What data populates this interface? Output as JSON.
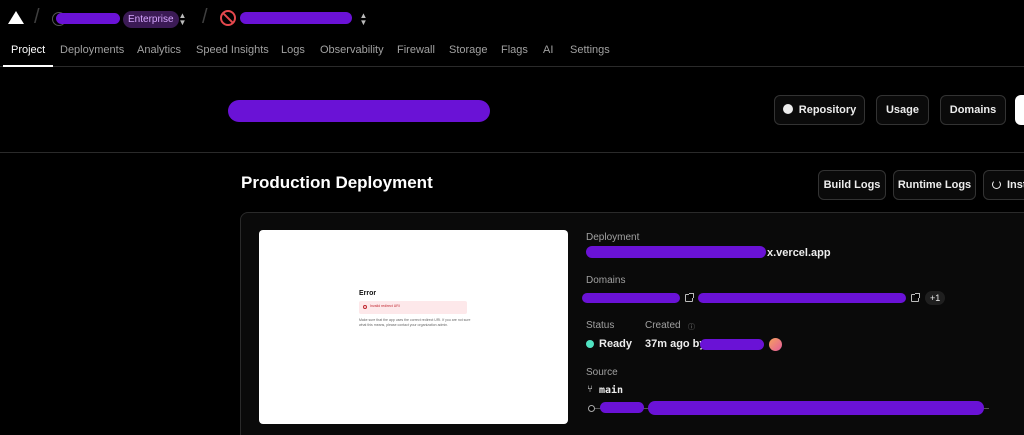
{
  "topbar": {
    "plan_badge": "Enterprise"
  },
  "tabs": [
    "Project",
    "Deployments",
    "Analytics",
    "Speed Insights",
    "Logs",
    "Observability",
    "Firewall",
    "Storage",
    "Flags",
    "AI",
    "Settings"
  ],
  "header": {
    "buttons": {
      "repository": "Repository",
      "usage": "Usage",
      "domains": "Domains"
    }
  },
  "production": {
    "title": "Production Deployment",
    "buttons": {
      "build_logs": "Build Logs",
      "runtime_logs": "Runtime Logs",
      "instant_rollback": "Inst"
    },
    "preview": {
      "error_title": "Error",
      "alert_text": "Invalid redirect URI",
      "body_text": "Make sure that the app uses the correct redirect URI. If you are not sure what this means, please contact your organization admin."
    },
    "labels": {
      "deployment": "Deployment",
      "domains": "Domains",
      "status": "Status",
      "created": "Created",
      "source": "Source"
    },
    "deployment_url_suffix": "x.vercel.app",
    "domains_extra_count": "+1",
    "status_value": "Ready",
    "created_value": "37m ago by",
    "branch": "main"
  },
  "colors": {
    "accent_ready": "#50e3c2",
    "enterprise_badge_bg": "#3b1a55",
    "enterprise_badge_text": "#d7a6ff",
    "blocked_icon": "#e5484d"
  }
}
